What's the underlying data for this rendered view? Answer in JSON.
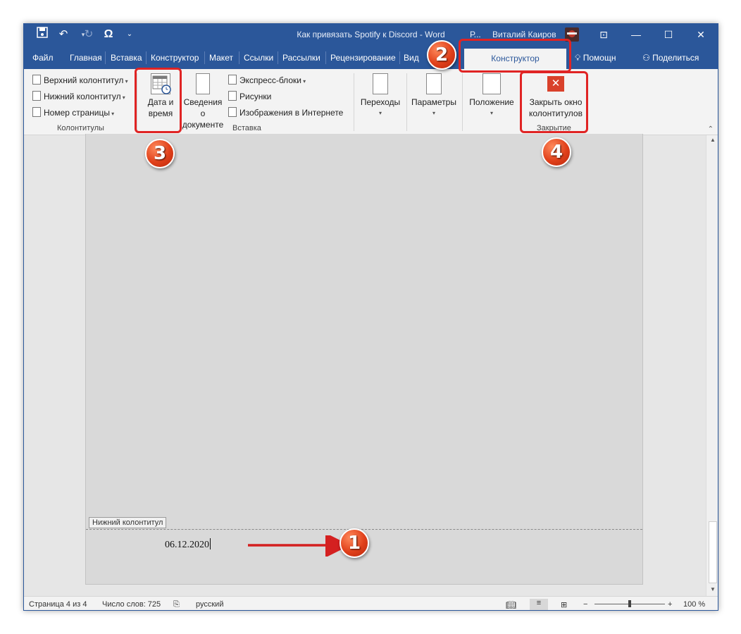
{
  "window": {
    "doc_title": "Как привязать Spotify к Discord - Word",
    "user_short": "Р...",
    "user_name": "Виталий Каиров"
  },
  "quick_access": {
    "save_icon": "save-icon",
    "undo_icon": "undo-icon",
    "redo_icon": "redo-icon",
    "omega_glyph": "Ω",
    "customize_icon": "customize-icon"
  },
  "window_controls": {
    "ribbon_display": "⊡",
    "minimize": "—",
    "maximize": "☐",
    "close": "✕"
  },
  "tabs": [
    {
      "label": "Файл"
    },
    {
      "label": "Главная"
    },
    {
      "label": "Вставка"
    },
    {
      "label": "Конструктор"
    },
    {
      "label": "Макет"
    },
    {
      "label": "Ссылки"
    },
    {
      "label": "Рассылки"
    },
    {
      "label": "Рецензирование"
    },
    {
      "label": "Вид"
    }
  ],
  "active_tab": "Конструктор",
  "tell_me": "Помощн",
  "share": "Поделиться",
  "ribbon": {
    "kolontituly": {
      "header": "Верхний колонтитул",
      "footer": "Нижний колонтитул",
      "page_number": "Номер страницы",
      "group_label": "Колонтитулы"
    },
    "vstavka": {
      "date_time_line1": "Дата и",
      "date_time_line2": "время",
      "doc_info_line1": "Сведения о",
      "doc_info_line2": "документе",
      "express_blocks": "Экспресс-блоки",
      "pictures": "Рисунки",
      "online_pictures": "Изображения в Интернете",
      "group_label": "Вставка"
    },
    "navigation": "Переходы",
    "options": "Параметры",
    "position": "Положение",
    "close": {
      "line1": "Закрыть окно",
      "line2": "колонтитулов",
      "group_label": "Закрытие"
    }
  },
  "document": {
    "footer_tag": "Нижний колонтитул",
    "footer_text": "06.12.2020"
  },
  "status": {
    "page": "Страница 4 из 4",
    "words": "Число слов: 725",
    "language": "русский",
    "zoom": "100 %",
    "zoom_minus": "−",
    "zoom_plus": "+"
  },
  "annotations": [
    "1",
    "2",
    "3",
    "4"
  ],
  "colors": {
    "word_blue": "#2b579a",
    "highlight_red": "#e02424",
    "badge_orange": "#e0401a"
  }
}
